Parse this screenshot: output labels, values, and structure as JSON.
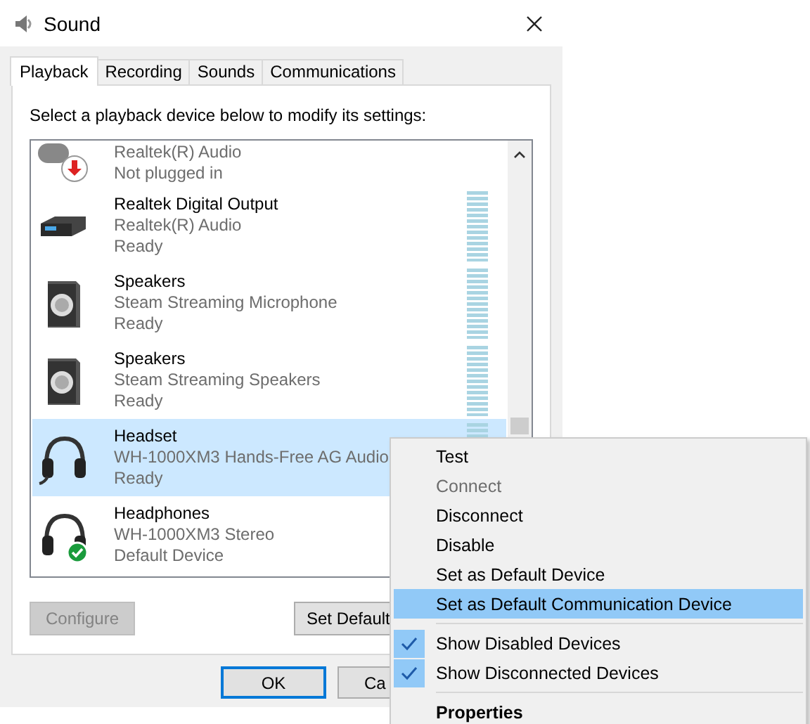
{
  "window": {
    "title": "Sound"
  },
  "tabs": [
    {
      "label": "Playback",
      "selected": true
    },
    {
      "label": "Recording",
      "selected": false
    },
    {
      "label": "Sounds",
      "selected": false
    },
    {
      "label": "Communications",
      "selected": false
    }
  ],
  "instruction": "Select a playback device below to modify its settings:",
  "devices": [
    {
      "description": "Realtek(R) Audio",
      "status": "Not plugged in",
      "kind": "unplugged",
      "meter": false,
      "selected": false
    },
    {
      "name": "Realtek Digital Output",
      "description": "Realtek(R) Audio",
      "status": "Ready",
      "kind": "digital",
      "meter": true,
      "selected": false
    },
    {
      "name": "Speakers",
      "description": "Steam Streaming Microphone",
      "status": "Ready",
      "kind": "speaker",
      "meter": true,
      "selected": false
    },
    {
      "name": "Speakers",
      "description": "Steam Streaming Speakers",
      "status": "Ready",
      "kind": "speaker",
      "meter": true,
      "selected": false
    },
    {
      "name": "Headset",
      "description": "WH-1000XM3 Hands-Free AG Audio",
      "status": "Ready",
      "kind": "headset",
      "meter": true,
      "selected": true
    },
    {
      "name": "Headphones",
      "description": "WH-1000XM3 Stereo",
      "status": "Default Device",
      "kind": "headphones-default",
      "meter": false,
      "selected": false
    }
  ],
  "buttons": [
    {
      "label": "Configure",
      "disabled": true
    },
    {
      "label": "Set Default",
      "disabled": false
    }
  ],
  "dialog_buttons": [
    {
      "label": "OK",
      "default": true
    },
    {
      "label": "Ca",
      "default": false
    }
  ],
  "context_menu": [
    {
      "kind": "item",
      "label": "Test",
      "disabled": false,
      "checked": false,
      "selected": false,
      "bold": false
    },
    {
      "kind": "item",
      "label": "Connect",
      "disabled": true,
      "checked": false,
      "selected": false,
      "bold": false
    },
    {
      "kind": "item",
      "label": "Disconnect",
      "disabled": false,
      "checked": false,
      "selected": false,
      "bold": false
    },
    {
      "kind": "item",
      "label": "Disable",
      "disabled": false,
      "checked": false,
      "selected": false,
      "bold": false
    },
    {
      "kind": "item",
      "label": "Set as Default Device",
      "disabled": false,
      "checked": false,
      "selected": false,
      "bold": false
    },
    {
      "kind": "item",
      "label": "Set as Default Communication Device",
      "disabled": false,
      "checked": false,
      "selected": true,
      "bold": false
    },
    {
      "kind": "separator"
    },
    {
      "kind": "item",
      "label": "Show Disabled Devices",
      "disabled": false,
      "checked": true,
      "selected": false,
      "bold": false
    },
    {
      "kind": "item",
      "label": "Show Disconnected Devices",
      "disabled": false,
      "checked": true,
      "selected": false,
      "bold": false
    },
    {
      "kind": "separator"
    },
    {
      "kind": "item",
      "label": "Properties",
      "disabled": false,
      "checked": false,
      "selected": false,
      "bold": true
    }
  ]
}
